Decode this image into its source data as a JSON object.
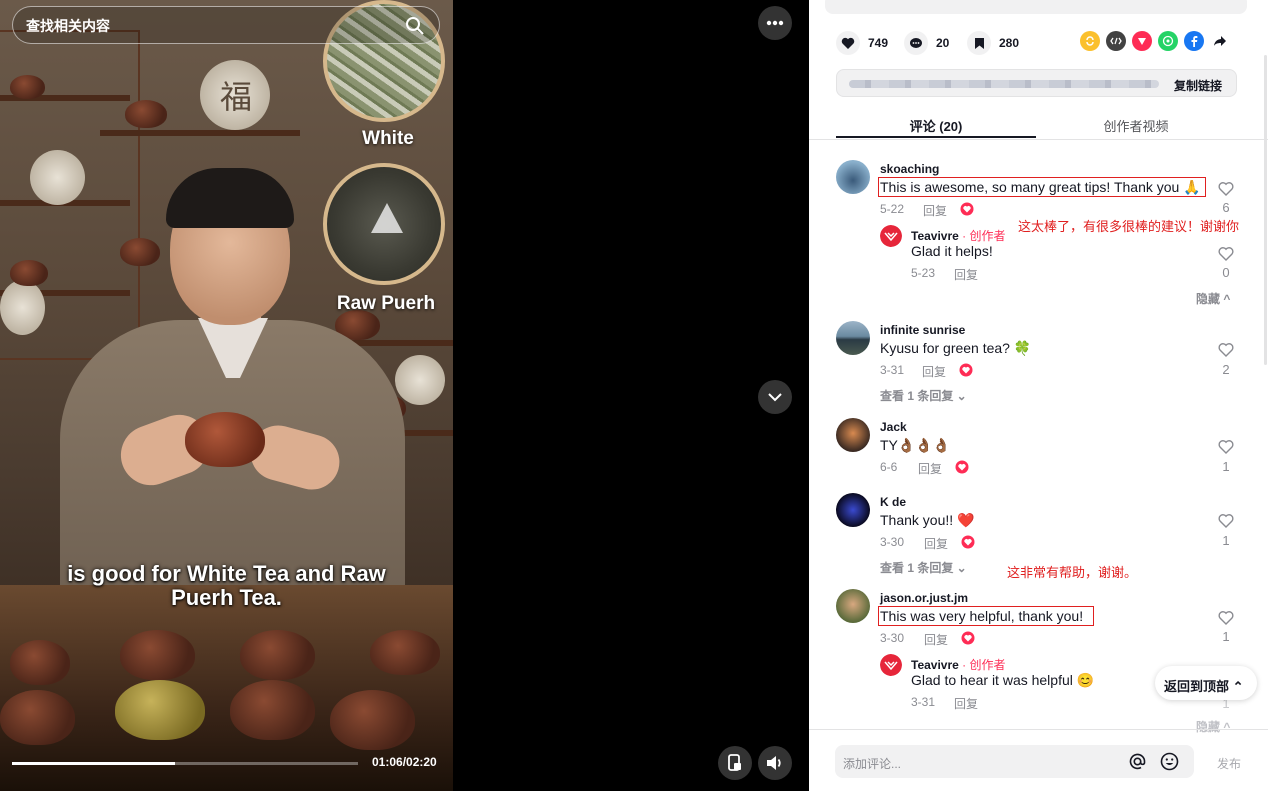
{
  "video": {
    "search_placeholder": "查找相关内容",
    "tea_labels": [
      "White",
      "Raw Puerh"
    ],
    "caption_line1": "is good for White Tea and Raw",
    "caption_line2": "Puerh Tea.",
    "time": "01:06/02:20",
    "progress": 0.47,
    "decorative_char": "福"
  },
  "stats": {
    "likes": "749",
    "comments": "20",
    "saves": "280"
  },
  "share_icons": [
    "repost-icon",
    "embed-icon",
    "telegram-icon",
    "whatsapp-icon",
    "facebook-icon",
    "share-arrow-icon"
  ],
  "link": {
    "copy_label": "复制链接"
  },
  "tabs": {
    "comments": "评论 (20)",
    "creator_videos": "创作者视频"
  },
  "comments": [
    {
      "user": "skoaching",
      "text": "This is awesome, so many great tips! Thank you 🙏",
      "date": "5-22",
      "reply_label": "回复",
      "likes": "6",
      "reply": {
        "user": "Teavivre",
        "creator_tag": "· 创作者",
        "text": "Glad it helps!",
        "date": "5-23",
        "reply_label": "回复",
        "likes": "0"
      },
      "hide_label": "隐藏 ^"
    },
    {
      "user": "infinite sunrise",
      "text": "Kyusu for green tea? 🍀",
      "date": "3-31",
      "reply_label": "回复",
      "likes": "2",
      "view_replies": "查看 1 条回复 ⌄"
    },
    {
      "user": "Jack",
      "text": "TY👌🏾👌🏾👌🏾",
      "date": "6-6",
      "reply_label": "回复",
      "likes": "1"
    },
    {
      "user": "K de",
      "text": "Thank you!! ❤️",
      "date": "3-30",
      "reply_label": "回复",
      "likes": "1",
      "view_replies": "查看 1 条回复 ⌄"
    },
    {
      "user": "jason.or.just.jm",
      "text": "This was very helpful, thank you!",
      "date": "3-30",
      "reply_label": "回复",
      "likes": "1",
      "reply": {
        "user": "Teavivre",
        "creator_tag": "· 创作者",
        "text": "Glad to hear it was helpful 😊",
        "date": "3-31",
        "reply_label": "回复",
        "likes": "1"
      },
      "hide_label": "隐藏 ^"
    }
  ],
  "annotations": {
    "translation_1": "这太棒了，有很多很棒的建议！谢谢你",
    "translation_2": "这非常有帮助，谢谢。"
  },
  "back_to_top": "返回到顶部 ⌃",
  "comment_box": {
    "placeholder": "添加评论...",
    "post_label": "发布"
  },
  "colors": {
    "accent_red": "#fe2c55",
    "annotation_red": "#e02020",
    "text_gray": "#8a8b91"
  }
}
